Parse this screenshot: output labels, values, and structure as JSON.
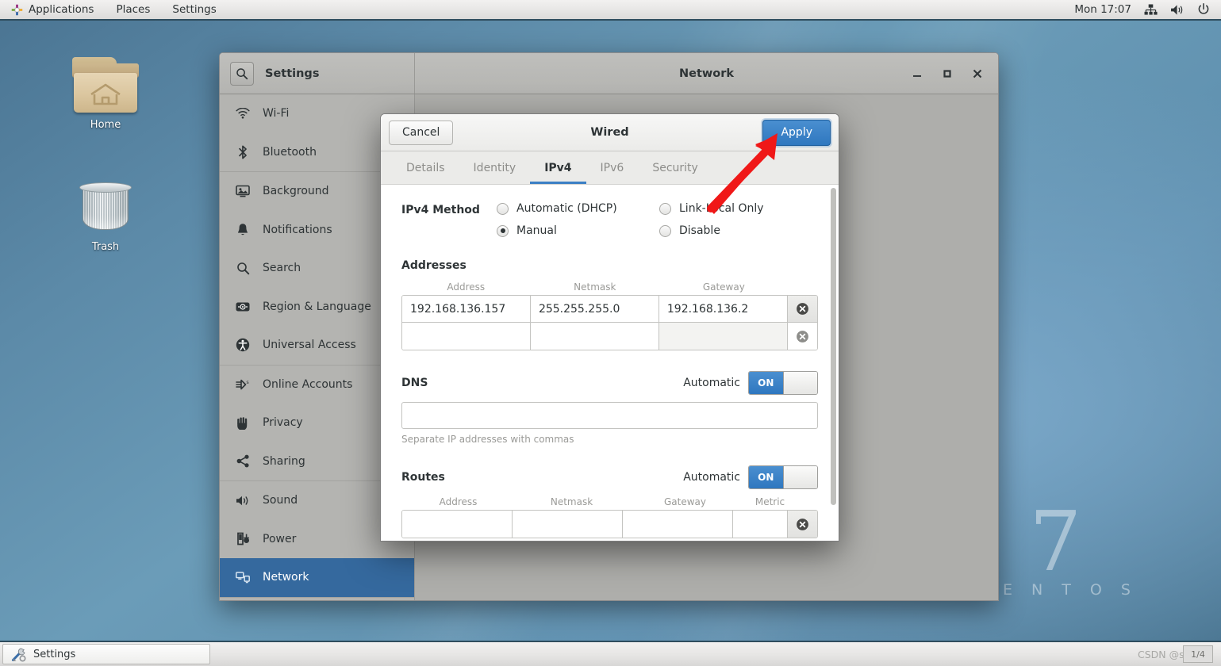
{
  "topbar": {
    "activities_icon": "centos-logo-icon",
    "menus": [
      "Applications",
      "Places",
      "Settings"
    ],
    "clock": "Mon 17:07",
    "tray": [
      "network-icon",
      "volume-icon",
      "power-icon"
    ]
  },
  "desktop": {
    "icons": [
      {
        "label": "Home",
        "icon": "home-folder-icon"
      },
      {
        "label": "Trash",
        "icon": "trash-can-icon"
      }
    ],
    "watermark": {
      "version": "7",
      "name": "C E N T O S"
    }
  },
  "settings_window": {
    "search_icon": "search-icon",
    "title_left": "Settings",
    "title_right": "Network",
    "window_controls": {
      "minimize": "minimize-icon",
      "maximize": "maximize-icon",
      "close": "close-icon"
    },
    "sidebar": {
      "items": [
        {
          "label": "Wi-Fi",
          "icon": "wifi-icon",
          "selected": false
        },
        {
          "label": "Bluetooth",
          "icon": "bluetooth-icon",
          "selected": false
        },
        {
          "label": "Background",
          "icon": "background-icon",
          "selected": false
        },
        {
          "label": "Notifications",
          "icon": "bell-icon",
          "selected": false
        },
        {
          "label": "Search",
          "icon": "search-icon",
          "selected": false
        },
        {
          "label": "Region & Language",
          "icon": "region-language-icon",
          "selected": false
        },
        {
          "label": "Universal Access",
          "icon": "universal-access-icon",
          "selected": false
        },
        {
          "label": "Online Accounts",
          "icon": "online-accounts-icon",
          "selected": false
        },
        {
          "label": "Privacy",
          "icon": "privacy-hand-icon",
          "selected": false
        },
        {
          "label": "Sharing",
          "icon": "sharing-icon",
          "selected": false
        },
        {
          "label": "Sound",
          "icon": "sound-icon",
          "selected": false
        },
        {
          "label": "Power",
          "icon": "power-plug-icon",
          "selected": false
        },
        {
          "label": "Network",
          "icon": "network-icon",
          "selected": true
        }
      ]
    },
    "network_panel": {
      "add_button_label": "+",
      "gear_icon": "gear-icon"
    }
  },
  "wired_dialog": {
    "title": "Wired",
    "cancel_label": "Cancel",
    "apply_label": "Apply",
    "tabs": [
      {
        "label": "Details",
        "active": false
      },
      {
        "label": "Identity",
        "active": false
      },
      {
        "label": "IPv4",
        "active": true
      },
      {
        "label": "IPv6",
        "active": false
      },
      {
        "label": "Security",
        "active": false
      }
    ],
    "ipv4_method": {
      "label": "IPv4 Method",
      "options": [
        {
          "label": "Automatic (DHCP)",
          "selected": false
        },
        {
          "label": "Manual",
          "selected": true
        },
        {
          "label": "Link-Local Only",
          "selected": false
        },
        {
          "label": "Disable",
          "selected": false
        }
      ]
    },
    "addresses": {
      "label": "Addresses",
      "columns": [
        "Address",
        "Netmask",
        "Gateway"
      ],
      "rows": [
        {
          "address": "192.168.136.157",
          "netmask": "255.255.255.0",
          "gateway": "192.168.136.2"
        },
        {
          "address": "",
          "netmask": "",
          "gateway": ""
        }
      ],
      "delete_icon": "delete-circle-icon"
    },
    "dns": {
      "label": "DNS",
      "automatic_label": "Automatic",
      "toggle_state": "ON",
      "value": "",
      "hint": "Separate IP addresses with commas"
    },
    "routes": {
      "label": "Routes",
      "automatic_label": "Automatic",
      "toggle_state": "ON",
      "columns": [
        "Address",
        "Netmask",
        "Gateway",
        "Metric"
      ],
      "rows": [
        {
          "address": "",
          "netmask": "",
          "gateway": "",
          "metric": ""
        }
      ],
      "delete_icon": "delete-circle-icon"
    },
    "annotation": {
      "type": "red-arrow",
      "points_to": "Apply"
    }
  },
  "bottombar": {
    "task_label": "Settings",
    "task_icon": "settings-tools-icon",
    "watermark": "CSDN @scan...",
    "workspace": "1/4"
  },
  "colors": {
    "accent_blue": "#2f77bf",
    "selected_blue": "#35699e",
    "annotation_red": "#f01818",
    "chrome_gray": "#b4b4b1"
  }
}
